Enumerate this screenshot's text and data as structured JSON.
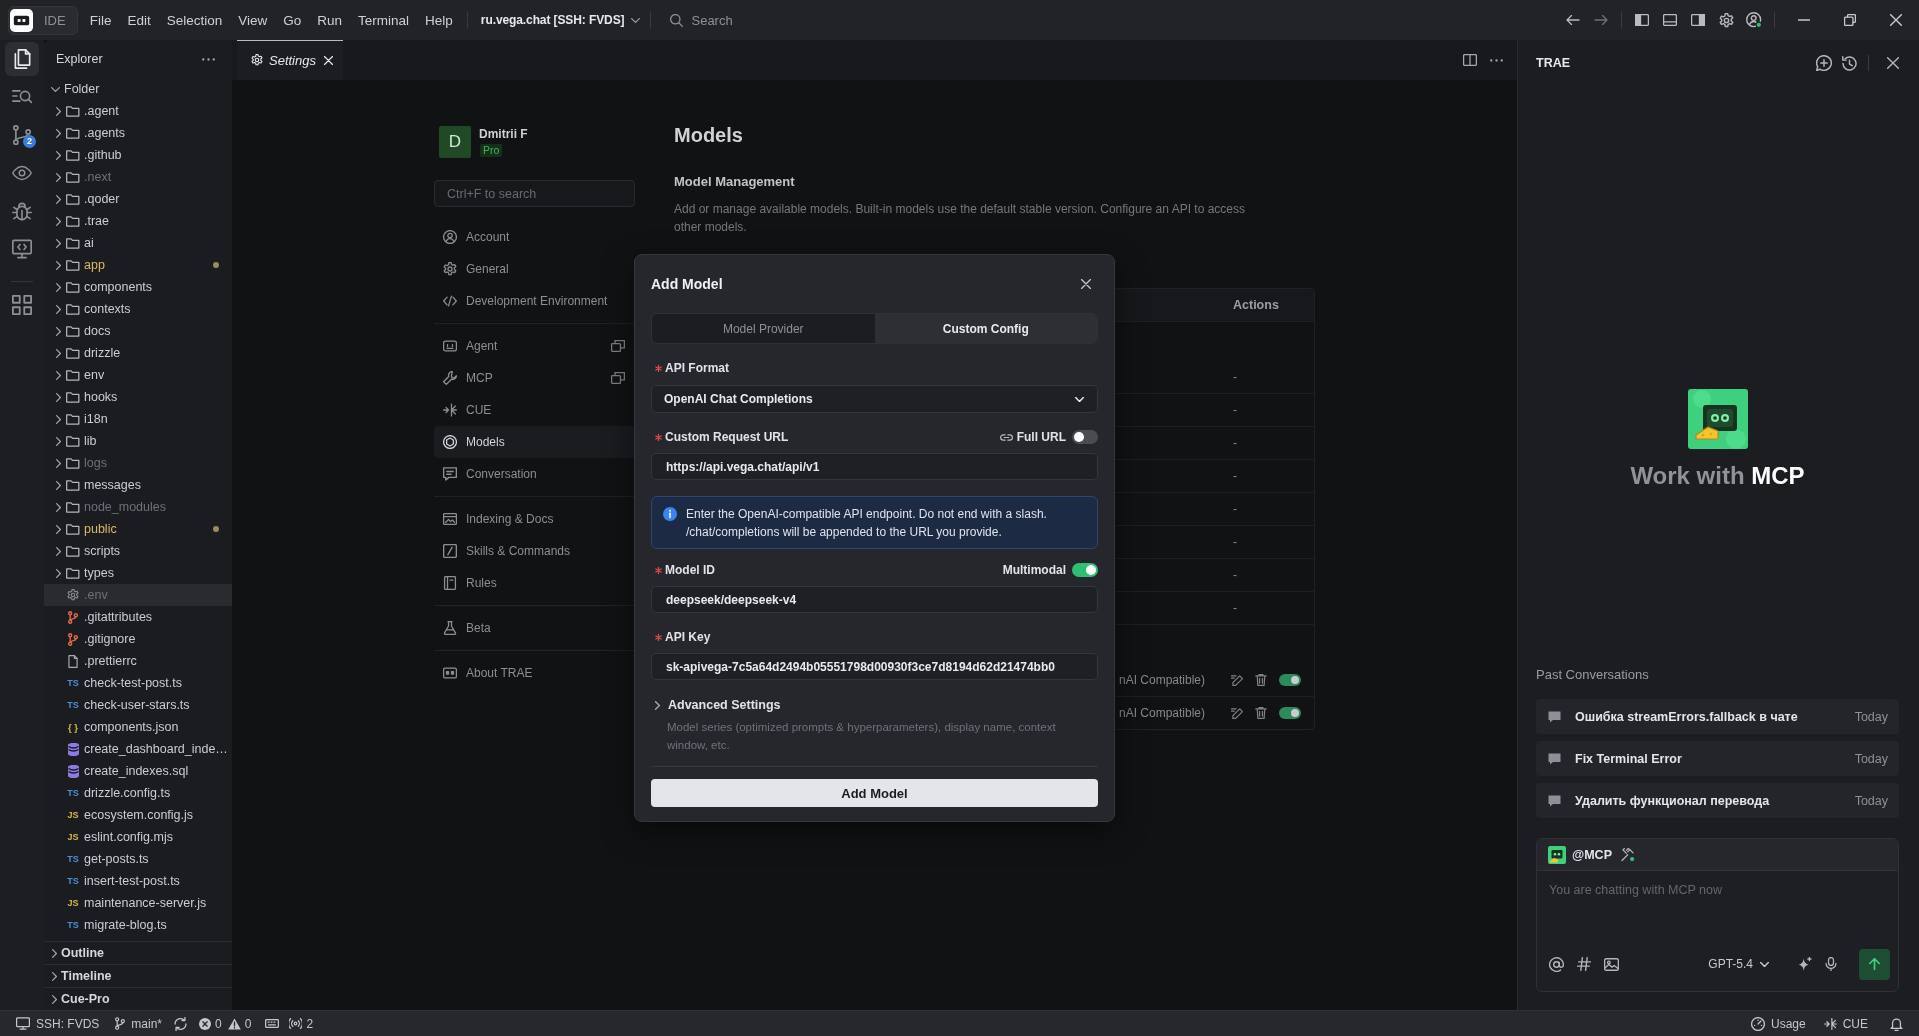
{
  "title_bar": {
    "app_label": "IDE",
    "menu": [
      "File",
      "Edit",
      "Selection",
      "View",
      "Go",
      "Run",
      "Terminal",
      "Help"
    ],
    "workspace": "ru.vega.chat [SSH: FVDS]",
    "search": {
      "placeholder": "Search"
    }
  },
  "activity_bar": [
    {
      "items": [
        {
          "selected": true
        },
        {
          "selected": false
        },
        {
          "selected": false,
          "badge": "2"
        },
        {
          "selected": false
        },
        {
          "selected": false
        },
        {
          "selected": false
        }
      ]
    },
    {
      "items": [
        {
          "selected": false
        }
      ]
    }
  ],
  "explorer": {
    "title": "Explorer",
    "tree": [
      {
        "label": "Folder",
        "kind": "root",
        "expanded": true,
        "children": [
          {
            "label": ".agent",
            "kind": "folder",
            "expanded": false,
            "selected": false,
            "ignored": false,
            "modified": false
          },
          {
            "label": ".agents",
            "kind": "folder",
            "expanded": false,
            "selected": false,
            "ignored": false,
            "modified": false
          },
          {
            "label": ".github",
            "kind": "folder",
            "expanded": false,
            "selected": false,
            "ignored": false,
            "modified": false
          },
          {
            "label": ".next",
            "kind": "folder",
            "expanded": false,
            "selected": false,
            "ignored": true,
            "modified": false
          },
          {
            "label": ".qoder",
            "kind": "folder",
            "expanded": false,
            "selected": false,
            "ignored": false,
            "modified": false
          },
          {
            "label": ".trae",
            "kind": "folder",
            "expanded": false,
            "selected": false,
            "ignored": false,
            "modified": false
          },
          {
            "label": "ai",
            "kind": "folder",
            "expanded": false,
            "selected": false,
            "ignored": false,
            "modified": false
          },
          {
            "label": "app",
            "kind": "folder",
            "expanded": false,
            "selected": false,
            "ignored": false,
            "modified": true
          },
          {
            "label": "components",
            "kind": "folder",
            "expanded": false,
            "selected": false,
            "ignored": false,
            "modified": false
          },
          {
            "label": "contexts",
            "kind": "folder",
            "expanded": false,
            "selected": false,
            "ignored": false,
            "modified": false
          },
          {
            "label": "docs",
            "kind": "folder",
            "expanded": false,
            "selected": false,
            "ignored": false,
            "modified": false
          },
          {
            "label": "drizzle",
            "kind": "folder",
            "expanded": false,
            "selected": false,
            "ignored": false,
            "modified": false
          },
          {
            "label": "env",
            "kind": "folder",
            "expanded": false,
            "selected": false,
            "ignored": false,
            "modified": false
          },
          {
            "label": "hooks",
            "kind": "folder",
            "expanded": false,
            "selected": false,
            "ignored": false,
            "modified": false
          },
          {
            "label": "i18n",
            "kind": "folder",
            "expanded": false,
            "selected": false,
            "ignored": false,
            "modified": false
          },
          {
            "label": "lib",
            "kind": "folder",
            "expanded": false,
            "selected": false,
            "ignored": false,
            "modified": false
          },
          {
            "label": "logs",
            "kind": "folder",
            "expanded": false,
            "selected": false,
            "ignored": true,
            "modified": false
          },
          {
            "label": "messages",
            "kind": "folder",
            "expanded": false,
            "selected": false,
            "ignored": false,
            "modified": false
          },
          {
            "label": "node_modules",
            "kind": "folder",
            "expanded": false,
            "selected": false,
            "ignored": true,
            "modified": false
          },
          {
            "label": "public",
            "kind": "folder",
            "expanded": false,
            "selected": false,
            "ignored": false,
            "modified": true
          },
          {
            "label": "scripts",
            "kind": "folder",
            "expanded": false,
            "selected": false,
            "ignored": false,
            "modified": false
          },
          {
            "label": "types",
            "kind": "folder",
            "expanded": false,
            "selected": false,
            "ignored": false,
            "modified": false
          },
          {
            "label": ".env",
            "kind": "env",
            "selected": true,
            "ignored": true,
            "modified": false
          },
          {
            "label": ".gitattributes",
            "kind": "git",
            "selected": false,
            "ignored": false,
            "modified": false
          },
          {
            "label": ".gitignore",
            "kind": "git",
            "selected": false,
            "ignored": false,
            "modified": false
          },
          {
            "label": ".prettierrc",
            "kind": "file",
            "selected": false,
            "ignored": false,
            "modified": false
          },
          {
            "label": "check-test-post.ts",
            "kind": "ts",
            "badge": "TS",
            "selected": false,
            "ignored": false,
            "modified": false
          },
          {
            "label": "check-user-stars.ts",
            "kind": "ts",
            "badge": "TS",
            "selected": false,
            "ignored": false,
            "modified": false
          },
          {
            "label": "components.json",
            "kind": "json",
            "badge": "{ }",
            "selected": false,
            "ignored": false,
            "modified": false
          },
          {
            "label": "create_dashboard_inde…",
            "kind": "sql",
            "selected": false,
            "ignored": false,
            "modified": false
          },
          {
            "label": "create_indexes.sql",
            "kind": "sql",
            "selected": false,
            "ignored": false,
            "modified": false
          },
          {
            "label": "drizzle.config.ts",
            "kind": "ts",
            "badge": "TS",
            "selected": false,
            "ignored": false,
            "modified": false
          },
          {
            "label": "ecosystem.config.js",
            "kind": "js",
            "badge": "JS",
            "selected": false,
            "ignored": false,
            "modified": false
          },
          {
            "label": "eslint.config.mjs",
            "kind": "js",
            "badge": "JS",
            "selected": false,
            "ignored": false,
            "modified": false
          },
          {
            "label": "get-posts.ts",
            "kind": "ts",
            "badge": "TS",
            "selected": false,
            "ignored": false,
            "modified": false
          },
          {
            "label": "insert-test-post.ts",
            "kind": "ts",
            "badge": "TS",
            "selected": false,
            "ignored": false,
            "modified": false
          },
          {
            "label": "maintenance-server.js",
            "kind": "js",
            "badge": "JS",
            "selected": false,
            "ignored": false,
            "modified": false
          },
          {
            "label": "migrate-blog.ts",
            "kind": "ts",
            "badge": "TS",
            "selected": false,
            "ignored": false,
            "modified": false
          }
        ]
      }
    ],
    "sections": [
      {
        "label": "Outline",
        "expanded": false
      },
      {
        "label": "Timeline",
        "expanded": false
      },
      {
        "label": "Cue-Pro",
        "expanded": false
      }
    ]
  },
  "editor": {
    "tabs": [
      {
        "label": "Settings",
        "selected": true,
        "preview": true
      }
    ]
  },
  "settings": {
    "profile": {
      "initial": "D",
      "name": "Dmitrii F",
      "plan": "Pro"
    },
    "search": {
      "placeholder": "Ctrl+F to search"
    },
    "nav_groups": [
      {
        "items": [
          {
            "label": "Account",
            "selected": false,
            "popout": false
          },
          {
            "label": "General",
            "selected": false,
            "popout": false
          },
          {
            "label": "Development Environment",
            "selected": false,
            "popout": false
          }
        ]
      },
      {
        "items": [
          {
            "label": "Agent",
            "selected": false,
            "popout": true
          },
          {
            "label": "MCP",
            "selected": false,
            "popout": true
          },
          {
            "label": "CUE",
            "selected": false,
            "popout": false
          },
          {
            "label": "Models",
            "selected": true,
            "popout": false
          },
          {
            "label": "Conversation",
            "selected": false,
            "popout": false
          }
        ]
      },
      {
        "items": [
          {
            "label": "Indexing & Docs",
            "selected": false,
            "popout": false
          },
          {
            "label": "Skills & Commands",
            "selected": false,
            "popout": false
          },
          {
            "label": "Rules",
            "selected": false,
            "popout": false
          }
        ]
      },
      {
        "items": [
          {
            "label": "Beta",
            "selected": false,
            "popout": false
          }
        ]
      },
      {
        "items": [
          {
            "label": "About TRAE",
            "selected": false,
            "popout": false
          }
        ]
      }
    ],
    "page_title": "Models",
    "section_title": "Model Management",
    "section_description": "Add or manage available models. Built-in models use the default stable version. Configure an API to access other models.",
    "models_table": {
      "columns": [
        "Actions"
      ],
      "groups": [
        {
          "rows": [
            {
              "kind": "builtin",
              "actions": "-"
            },
            {
              "kind": "builtin",
              "actions": "-"
            },
            {
              "kind": "builtin",
              "actions": "-"
            },
            {
              "kind": "builtin",
              "actions": "-"
            },
            {
              "kind": "builtin",
              "actions": "-"
            },
            {
              "kind": "builtin",
              "actions": "-"
            },
            {
              "kind": "builtin",
              "actions": "-"
            },
            {
              "kind": "builtin",
              "actions": "-"
            }
          ]
        },
        {
          "rows": [
            {
              "kind": "custom",
              "column_1": "nAI Compatible)",
              "enabled": true
            },
            {
              "kind": "custom",
              "column_1": "nAI Compatible)",
              "enabled": true
            }
          ]
        }
      ]
    }
  },
  "dialog": {
    "title": "Add Model",
    "tabs": [
      {
        "label": "Model Provider",
        "selected": false
      },
      {
        "label": "Custom Config",
        "selected": true
      }
    ],
    "fields": [
      {
        "kind": "select",
        "label": "API Format",
        "required": true,
        "value": "OpenAI Chat Completions"
      },
      {
        "kind": "input",
        "label": "Custom Request URL",
        "required": true,
        "value": "https://api.vega.chat/api/v1",
        "switch": {
          "kind": "link",
          "label": "Full URL",
          "on": false
        }
      },
      {
        "kind": "info",
        "text": "Enter the OpenAI-compatible API endpoint. Do not end with a slash. /chat/completions will be appended to the URL you provide."
      },
      {
        "kind": "input",
        "label": "Model ID",
        "required": true,
        "value": "deepseek/deepseek-v4",
        "switch": {
          "kind": "plain",
          "label": "Multimodal",
          "on": true
        }
      },
      {
        "kind": "input",
        "label": "API Key",
        "required": true,
        "value": "sk-apivega-7c5a64d2494b05551798d00930f3ce7d8194d62d21474bb0"
      }
    ],
    "advanced": {
      "label": "Advanced Settings",
      "expanded": false,
      "description": "Model series (optimized prompts & hyperparameters), display name, context window, etc."
    },
    "submit": "Add Model"
  },
  "assistant": {
    "title": "TRAE",
    "hero": "Work with **MCP**",
    "past_title": "Past Conversations",
    "conversations": [
      {
        "title": "Ошибка streamErrors.fallback в чате",
        "time": "Today"
      },
      {
        "title": "Fix Terminal Error",
        "time": "Today"
      },
      {
        "title": "Удалить функционал перевода",
        "time": "Today"
      }
    ],
    "composer": {
      "agent": "@MCP",
      "placeholder": "You are chatting with MCP now",
      "model": "GPT-5.4"
    }
  },
  "status_bar": {
    "remote": "SSH: FVDS",
    "branch": "main*",
    "errors": "0",
    "warnings": "0",
    "ports": "2",
    "usage": "Usage",
    "cue": "CUE"
  }
}
